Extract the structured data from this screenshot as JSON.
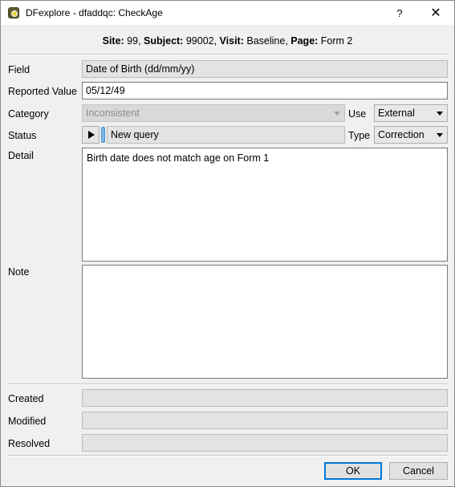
{
  "window": {
    "title": "DFexplore - dfaddqc: CheckAge",
    "help_label": "?",
    "close_label": "✕",
    "app_icon": "dfexplore-clock-icon"
  },
  "header": {
    "site_label": "Site:",
    "site_value": " 99,",
    "subject_label": " Subject:",
    "subject_value": " 99002,",
    "visit_label": " Visit:",
    "visit_value": " Baseline,",
    "page_label": " Page:",
    "page_value": " Form 2"
  },
  "form": {
    "field_label": "Field",
    "field_value": "Date of Birth (dd/mm/yy)",
    "reported_label": "Reported Value",
    "reported_value": "05/12/49",
    "category_label": "Category",
    "category_value": "Inconsistent",
    "use_label": "Use",
    "use_value": "External",
    "status_label": "Status",
    "status_value": "New query",
    "type_label": "Type",
    "type_value": "Correction",
    "detail_label": "Detail",
    "detail_value": "Birth date does not match age on Form 1",
    "note_label": "Note",
    "note_value": ""
  },
  "audit": {
    "created_label": "Created",
    "created_value": "",
    "modified_label": "Modified",
    "modified_value": "",
    "resolved_label": "Resolved",
    "resolved_value": ""
  },
  "buttons": {
    "ok_label": "OK",
    "cancel_label": "Cancel"
  }
}
